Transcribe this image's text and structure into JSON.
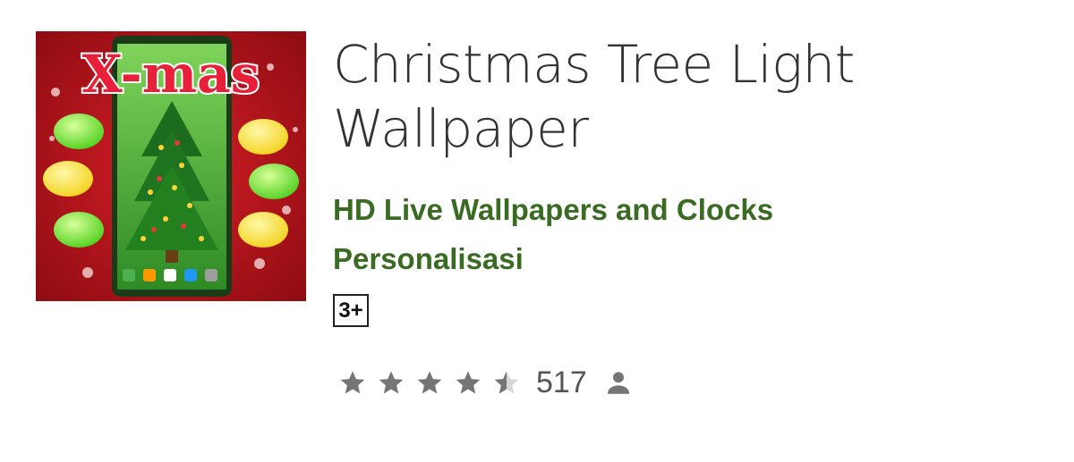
{
  "app": {
    "icon_name": "christmas-tree-app-icon",
    "icon_text": "X-mas",
    "title": "Christmas Tree Light Wallpaper",
    "developer": "HD Live Wallpapers and Clocks",
    "category": "Personalisasi",
    "content_rating": "3+",
    "rating": {
      "stars": 4.5,
      "max_stars": 5,
      "count": "517",
      "count_icon": "person-icon"
    }
  },
  "colors": {
    "developer_green": "#3a6b22",
    "title_text": "#333333",
    "star_gray": "#757575",
    "icon_red": "#b5121b",
    "icon_green": "#3f9a2c"
  }
}
